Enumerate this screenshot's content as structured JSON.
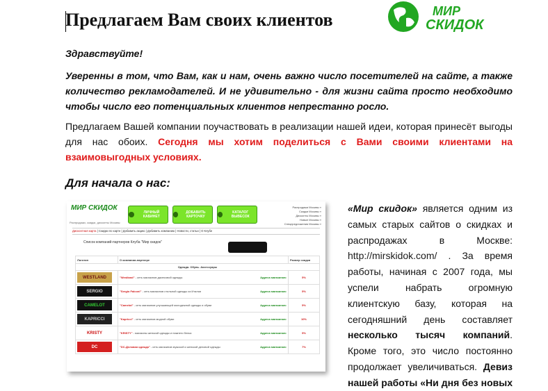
{
  "title": "Предлагаем Вам своих клиентов",
  "logo": {
    "text_line1": "МИР",
    "text_line2": "СКИДОК",
    "color": "#22a722"
  },
  "greeting": "Здравствуйте!",
  "intro": "Уверенны в том, что Вам, как и нам, очень важно число посетителей на сайте, а также количество рекламодателей. И не удивительно - для жизни сайта просто необходимо чтобы число его потенциальных клиентов непрестанно росло.",
  "offer": {
    "normal": "Предлагаем Вашей компании поучаствовать в реализации нашей идеи, которая принесёт выгоды для нас обоих. ",
    "highlight": "Сегодня мы хотим поделиться с Вами своими клиентами на взаимовыгодных условиях."
  },
  "subheading": "Для начала о нас:",
  "side": {
    "quote": "«Мир скидок»",
    "t1": " является одним из самых старых сайтов о скидках и распродажах в Москве: ",
    "link": "http://mirskidok.com/",
    "t2": " . За время работы, начиная с 2007 года, мы успели набрать огромную клиентскую базу, которая на сегодняшний день составляет ",
    "bold1": "несколько тысяч компаний",
    "t3": ". Кроме того, это число постоянно продолжает увеличиваться. ",
    "bold2": "Девиз нашей работы «Ни дня без новых"
  },
  "shot": {
    "logo": "МИР СКИДОК",
    "tagline": "Распродажи, скидки, дисконты Москвы",
    "buttons": [
      "ЛИЧНЫЙ КАБИНЕТ",
      "ДОБАВИТЬ КАРТОЧКУ",
      "КАТАЛОГ ВЫВЕСОК"
    ],
    "links": [
      "Распродажи Москвы »",
      "Скидки Москвы »",
      "Дисконты Москвы »",
      "Новые Москвы »",
      "Спецпредложения Москвы »"
    ],
    "menu": [
      "Дисконтная карта",
      "Скидки по карте",
      "Добавить акцию",
      "Добавить компанию",
      "Новости, статьи",
      "О Клубе"
    ],
    "heading": "Список компаний-партнеров Клуба \"Мир скидок\"",
    "col1": "Логотип",
    "col2": "О компании-партнере",
    "col3": "Размер скидки",
    "section": "Одежда. Обувь. Аксессуары",
    "rows": [
      {
        "logo": "WESTLAND",
        "name": "\"Westland\"",
        "desc": " - сеть магазинов джинсовой одежды",
        "addr": "Адреса магазинов:",
        "pct": "5%"
      },
      {
        "logo": "SERGIO",
        "name": "\"Sergio Falconi\"",
        "desc": " - сеть магазинов стильной одежды из Италии",
        "addr": "Адреса магазинов:",
        "pct": "5%"
      },
      {
        "logo": "CAMELOT",
        "name": "\"Camelot\"",
        "desc": " - сеть магазинов улучшающей молодежной одежды и обуви",
        "addr": "Адреса магазинов:",
        "pct": "5%"
      },
      {
        "logo": "KAPRICCI",
        "name": "\"Kapricci\"",
        "desc": " - сеть магазинов модной обуви",
        "addr": "Адреса магазинов:",
        "pct": "10%"
      },
      {
        "logo": "KRISTY",
        "name": "\"KRISTY\"",
        "desc": " - магазины женской одежды и нижнего белья",
        "addr": "Адреса магазинов:",
        "pct": "5%"
      },
      {
        "logo": "DC",
        "name": "\"DC-Деловая одежда\"",
        "desc": " - сеть магазинов мужской и женской деловой одежды",
        "addr": "Адреса магазинов:",
        "pct": "7%"
      }
    ]
  }
}
